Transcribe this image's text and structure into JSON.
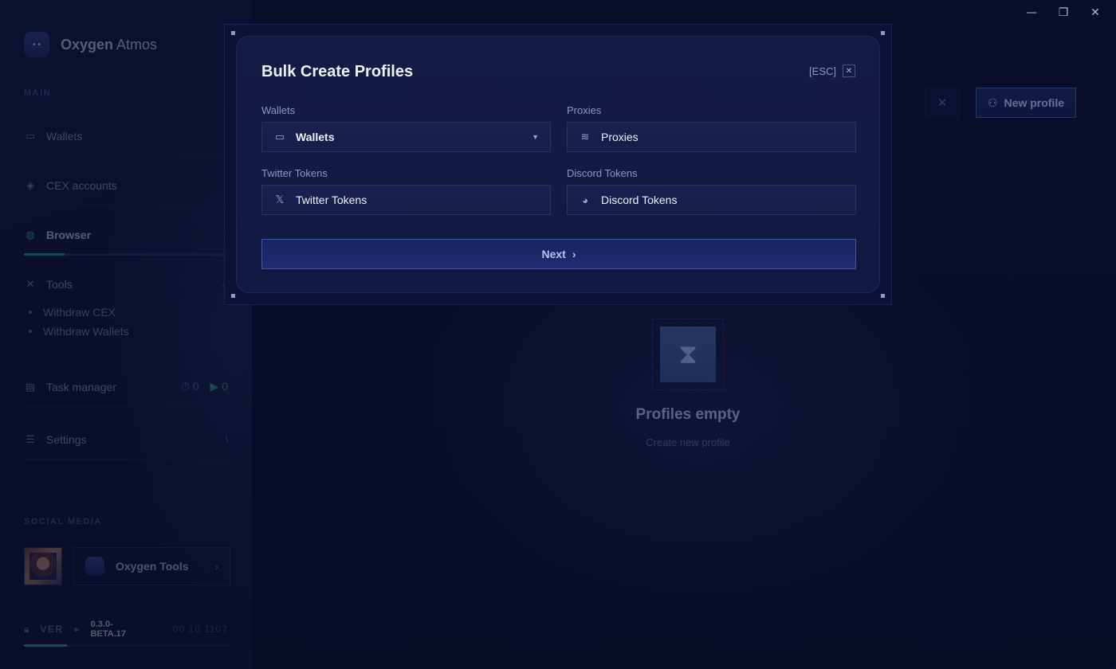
{
  "window": {
    "minimize": "—",
    "restore": "❐",
    "close": "✕"
  },
  "brand": {
    "name_bold": "Oxygen",
    "name_light": " Atmos"
  },
  "sidebar": {
    "main_label": "MAIN",
    "items": [
      {
        "label": "Wallets",
        "icon": "wallet-icon",
        "chevron": "▾"
      },
      {
        "label": "CEX accounts",
        "icon": "layers-icon",
        "chevron": "▾"
      },
      {
        "label": "Browser",
        "icon": "globe-icon",
        "chevron": "▾"
      },
      {
        "label": "Tools",
        "icon": "tools-icon",
        "chevron": "↗"
      },
      {
        "label": "Task manager",
        "icon": "tasks-icon"
      },
      {
        "label": "Settings",
        "icon": "sliders-icon",
        "chevron": "\\"
      }
    ],
    "tools_sub": [
      "Withdraw CEX",
      "Withdraw Wallets"
    ],
    "task_counts": {
      "scheduled": "0",
      "running": "0"
    },
    "social_label": "SOCIAL MEDIA",
    "social_card": {
      "label": "Oxygen Tools"
    },
    "version": {
      "label": "VER",
      "value": "0.3.0-BETA.17",
      "id": "00 10 1107"
    }
  },
  "main": {
    "new_profile_label": "New profile",
    "empty_title": "Profiles empty",
    "empty_subtitle": "Create new profile"
  },
  "modal": {
    "title": "Bulk Create Profiles",
    "esc_label": "[ESC]",
    "close": "✕",
    "wallets": {
      "label": "Wallets",
      "value": "Wallets"
    },
    "proxies": {
      "label": "Proxies",
      "value": "Proxies"
    },
    "twitter": {
      "label": "Twitter Tokens",
      "value": "Twitter Tokens"
    },
    "discord": {
      "label": "Discord Tokens",
      "value": "Discord Tokens"
    },
    "next_label": "Next"
  },
  "colors": {
    "accent_green": "#2fbf9b",
    "accent_blue": "#3d5aa8",
    "background": "#0b1030"
  }
}
